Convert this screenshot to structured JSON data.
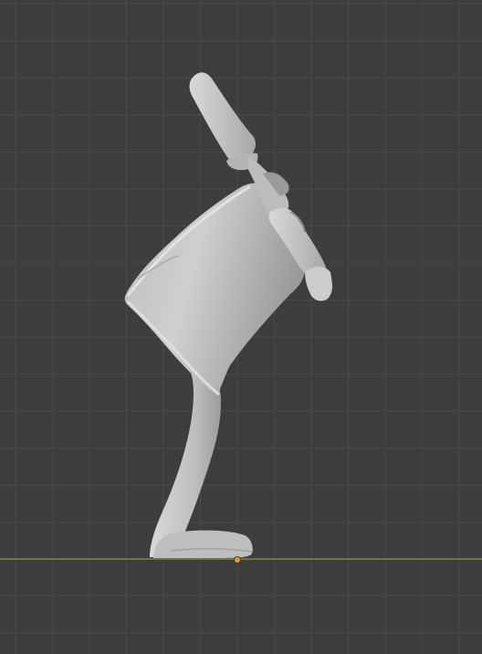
{
  "viewport": {
    "background_color": "#3d3d3d",
    "grid_line_color": "#4a4a4a",
    "grid_major_color": "#525252",
    "ground_axis_color": "#8a9a3a",
    "origin_marker_color": "#e8962c",
    "model_color": "#c4c4c4",
    "model_shadow_color": "#8e8e8e",
    "model_highlight_color": "#e6e6e6"
  },
  "scene": {
    "object": "chair-model-side-view",
    "view": "orthographic-side"
  }
}
